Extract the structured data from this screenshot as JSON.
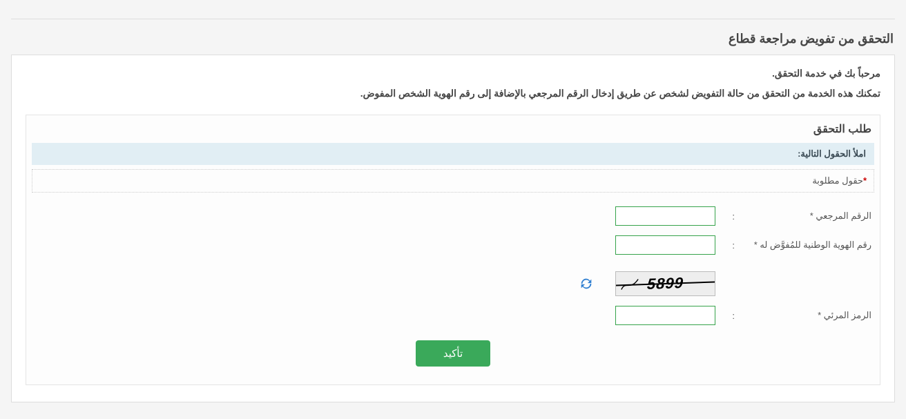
{
  "page_title": "التحقق من تفويض مراجعة قطاع",
  "intro_welcome": "مرحباً بك في خدمة التحقق.",
  "intro_desc": "تمكنك هذه الخدمة من التحقق من حالة التفويض لشخص عن طريق إدخال الرقم المرجعي بالإضافة إلى رقم الهوية الشخص المفوض.",
  "panel_title": "طلب التحقق",
  "info_bar": "املأ الحقول التالية:",
  "required_note_prefix": "*",
  "required_note": "حقول مطلوبة",
  "fields": {
    "ref_label": "الرقم المرجعي *",
    "ref_value": "",
    "nid_label": "رقم الهوية الوطنية للمُفوَّض له *",
    "nid_value": "",
    "captcha_label": "الرمز المرئي *",
    "captcha_value": ""
  },
  "colon": ":",
  "captcha_display": "5899",
  "confirm_button": "تأكيد"
}
